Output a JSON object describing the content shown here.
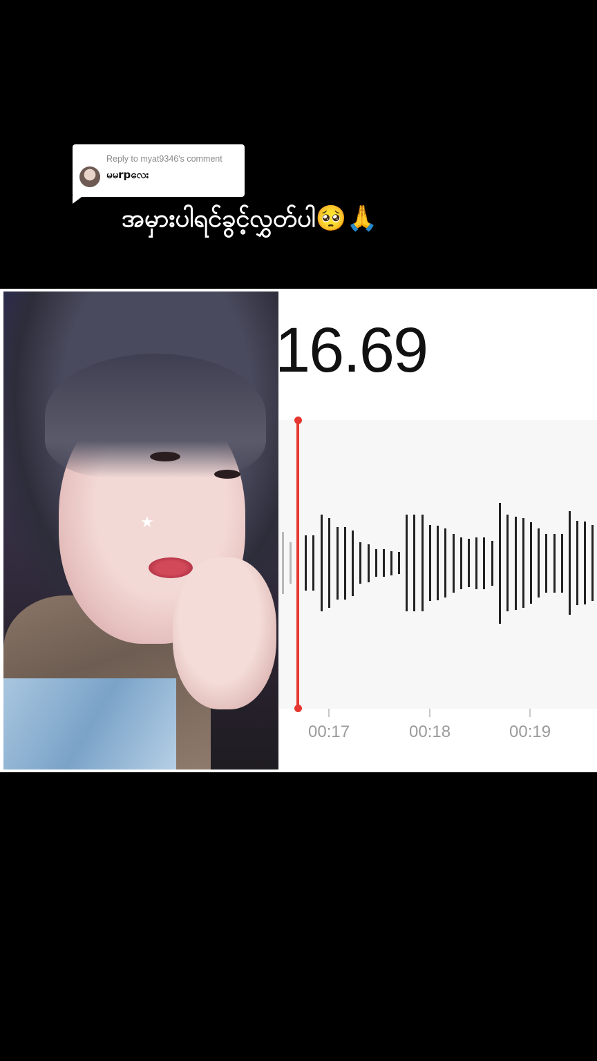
{
  "reply": {
    "header": "Reply to myat9346's comment",
    "username": "မမrpလေး"
  },
  "caption": "အမှားပါရင်ခွင့်လွှတ်ပါ🥺🙏",
  "recorder": {
    "timer": "16.69",
    "timeline_labels": [
      "00:17",
      "00:18",
      "00:19"
    ],
    "playhead_color": "#e5362f"
  }
}
